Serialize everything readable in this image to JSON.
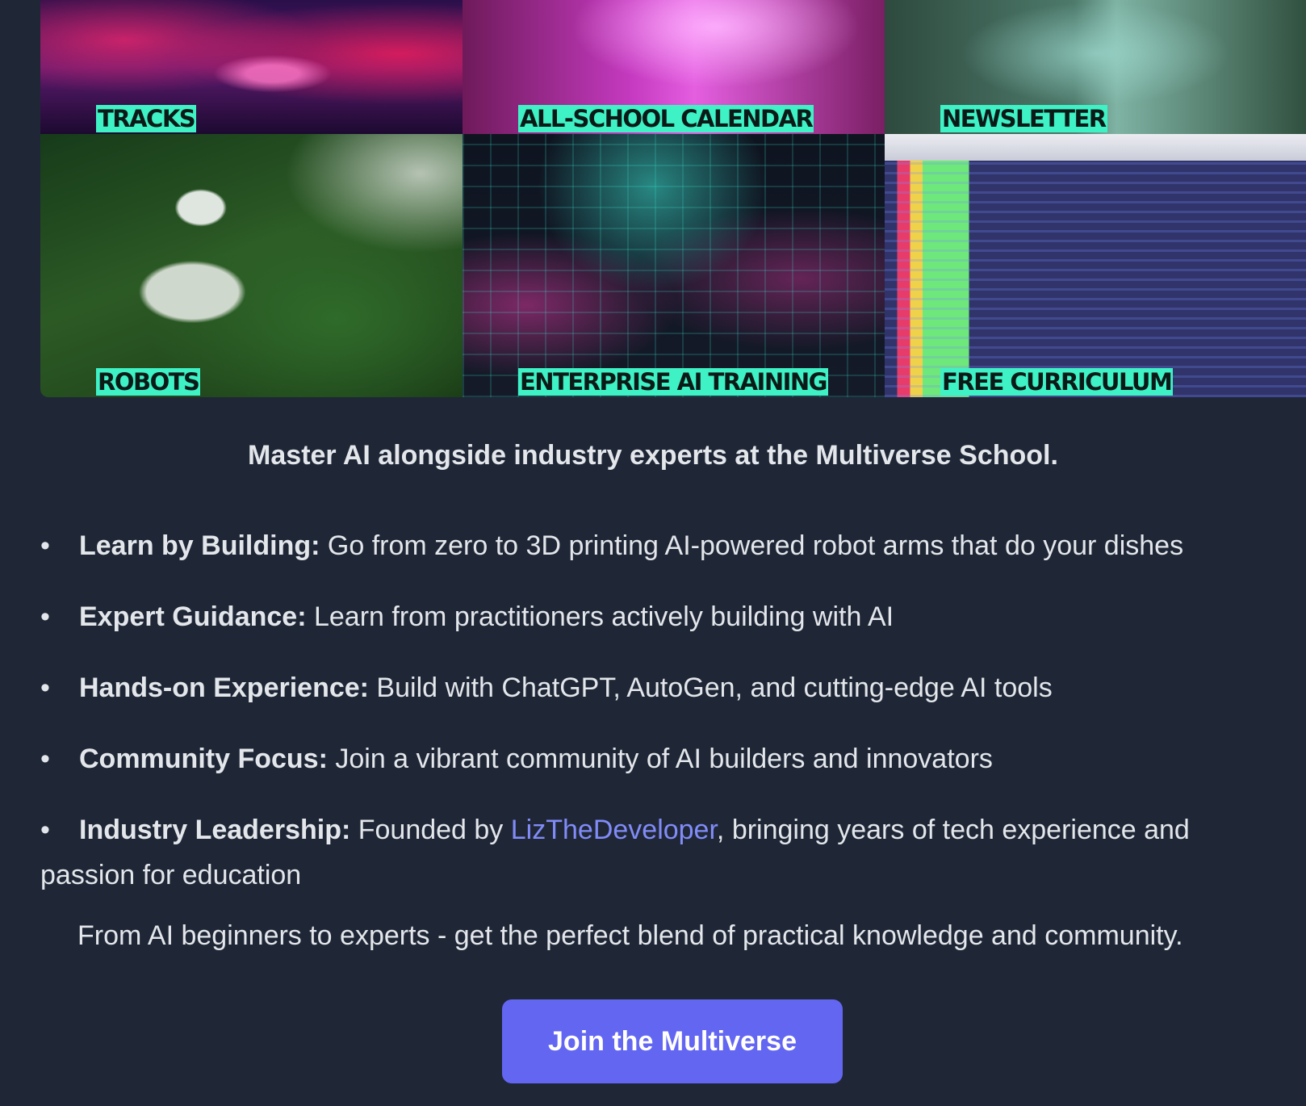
{
  "tiles": [
    {
      "label": "TRACKS"
    },
    {
      "label": "ALL-SCHOOL CALENDAR"
    },
    {
      "label": "NEWSLETTER"
    },
    {
      "label": "ROBOTS"
    },
    {
      "label": "ENTERPRISE AI TRAINING"
    },
    {
      "label": "FREE CURRICULUM"
    }
  ],
  "tagline": "Master AI alongside industry experts at the Multiverse School.",
  "features": [
    {
      "title": "Learn by Building:",
      "text": " Go from zero to 3D printing AI-powered robot arms that do your dishes"
    },
    {
      "title": "Expert Guidance:",
      "text": " Learn from practitioners actively building with AI"
    },
    {
      "title": "Hands-on Experience:",
      "text": " Build with ChatGPT, AutoGen, and cutting-edge AI tools"
    },
    {
      "title": "Community Focus:",
      "text": " Join a vibrant community of AI builders and innovators"
    },
    {
      "title": "Industry Leadership:",
      "text_before": " Founded by ",
      "link": "LizTheDeveloper",
      "text_after": ", bringing years of tech experience and passion for education"
    }
  ],
  "bullet": "•",
  "closing": "From AI beginners to experts - get the perfect blend of practical knowledge and community.",
  "cta": {
    "label": "Join the Multiverse"
  },
  "colors": {
    "background": "#1f2737",
    "label_bg": "#3ef2c6",
    "link": "#818cf8",
    "button": "#6366f1"
  }
}
